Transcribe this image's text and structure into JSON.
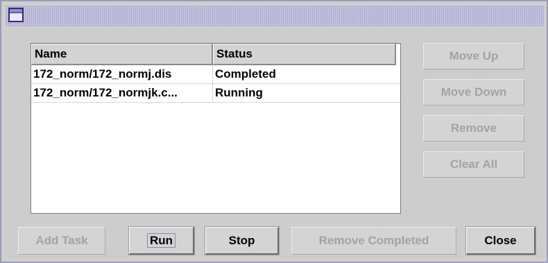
{
  "window": {
    "icon": "window-icon"
  },
  "table": {
    "columns": [
      "Name",
      "Status"
    ],
    "rows": [
      {
        "name": "172_norm/172_normj.dis",
        "status": "Completed"
      },
      {
        "name": "172_norm/172_normjk.c...",
        "status": "Running"
      }
    ]
  },
  "side_buttons": {
    "move_up": "Move Up",
    "move_down": "Move Down",
    "remove": "Remove",
    "clear_all": "Clear All"
  },
  "bottom_buttons": {
    "add_task": "Add Task",
    "run": "Run",
    "stop": "Stop",
    "remove_completed": "Remove Completed",
    "close": "Close"
  }
}
